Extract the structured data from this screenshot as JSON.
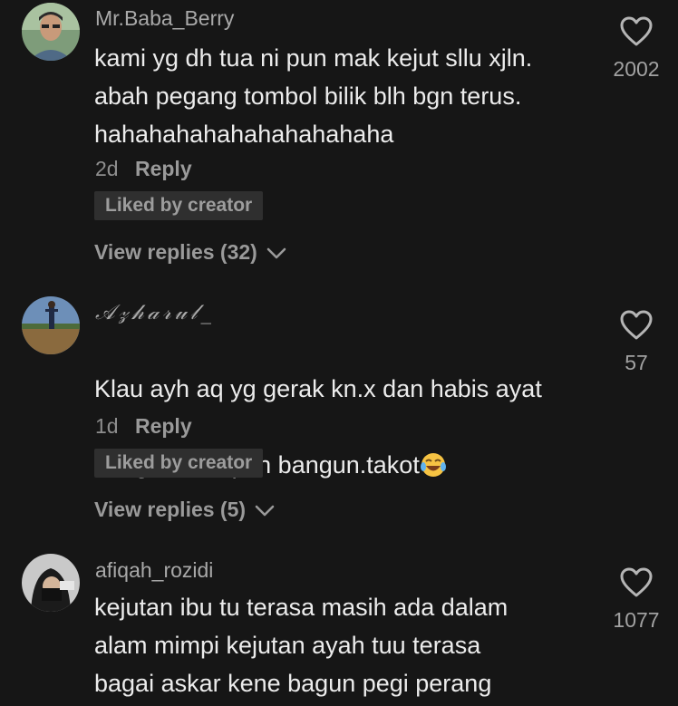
{
  "comments": [
    {
      "username": "Mr.Baba_Berry",
      "text": "kami yg dh tua ni pun mak kejut sllu xjln.\nabah pegang tombol bilik blh bgn terus.\nhahahahahahahahahahaha",
      "time": "2d",
      "reply_label": "Reply",
      "badge": "Liked by creator",
      "view_replies": "View replies (32)",
      "likes": "2002",
      "icons": {
        "like": "heart-outline-icon",
        "expand": "chevron-down-icon"
      }
    },
    {
      "username": "𝒜𝓏𝒽𝒶𝓇𝓊𝓁_",
      "text_line1": "Klau ayh aq yg gerak kn.x dan habis ayat",
      "text_line2": "bangun tu aq dh bangun.takot",
      "emoji": "face-with-tears-of-joy",
      "time": "1d",
      "reply_label": "Reply",
      "badge": "Liked by creator",
      "view_replies": "View replies (5)",
      "likes": "57",
      "icons": {
        "like": "heart-outline-icon",
        "expand": "chevron-down-icon"
      }
    },
    {
      "username": "afiqah_rozidi",
      "text": "kejutan ibu tu terasa masih ada dalam\nalam mimpi kejutan ayah tuu terasa\nbagai askar kene bagun pegi perang",
      "likes": "1077",
      "icons": {
        "like": "heart-outline-icon"
      }
    }
  ],
  "colors": {
    "background": "#161616",
    "primary_text": "#ececec",
    "secondary_text": "#a9a9a9",
    "badge_bg": "#2f2f2f"
  }
}
